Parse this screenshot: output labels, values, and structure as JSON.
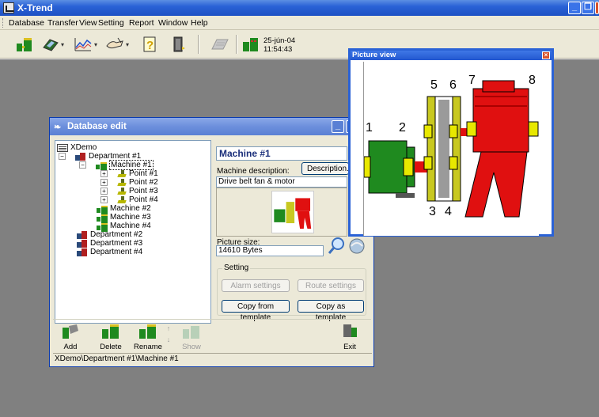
{
  "app": {
    "title": "X-Trend",
    "menu": [
      "Database",
      "Transfer",
      "View",
      "Setting",
      "Report",
      "Window",
      "Help"
    ],
    "clock": {
      "date": "25-jún-04",
      "time": "11:54:43"
    }
  },
  "db_window": {
    "title": "Database edit",
    "tree": [
      {
        "label": "XDemo",
        "icon": "database-icon"
      },
      {
        "label": "Department #1",
        "icon": "department-icon"
      },
      {
        "label": "Machine #1",
        "icon": "machine-icon",
        "selected": true
      },
      {
        "label": "Point #1",
        "icon": "point-icon"
      },
      {
        "label": "Point #2",
        "icon": "point-icon"
      },
      {
        "label": "Point #3",
        "icon": "point-icon"
      },
      {
        "label": "Point #4",
        "icon": "point-icon"
      },
      {
        "label": "Machine #2",
        "icon": "machine-icon"
      },
      {
        "label": "Machine #3",
        "icon": "machine-icon"
      },
      {
        "label": "Machine #4",
        "icon": "machine-icon"
      },
      {
        "label": "Department #2",
        "icon": "department-icon"
      },
      {
        "label": "Department #3",
        "icon": "department-icon"
      },
      {
        "label": "Department #4",
        "icon": "department-icon"
      }
    ],
    "item_title": "Machine #1",
    "machine_description_label": "Machine description:",
    "description_button": "Description...",
    "description_value": "Drive belt fan & motor",
    "picture_size_label": "Picture size:",
    "picture_size_value": "14610 Bytes",
    "setting_label": "Setting",
    "alarm_settings": "Alarm settings",
    "route_settings": "Route settings",
    "copy_from_template": "Copy from template",
    "copy_as_template": "Copy as template",
    "buttons": {
      "add": "Add",
      "delete": "Delete",
      "rename": "Rename",
      "show": "Show",
      "exit": "Exit"
    },
    "status_path": "XDemo\\Department #1\\Machine #1"
  },
  "picture_view": {
    "title": "Picture view",
    "labels": [
      "1",
      "2",
      "3",
      "4",
      "5",
      "6",
      "7",
      "8"
    ]
  },
  "colors": {
    "titlebar": "#2a62d6",
    "workspace": "#808080",
    "motor": "#1f8a1f",
    "fan": "#e01010",
    "coupling": "#e8e800"
  }
}
